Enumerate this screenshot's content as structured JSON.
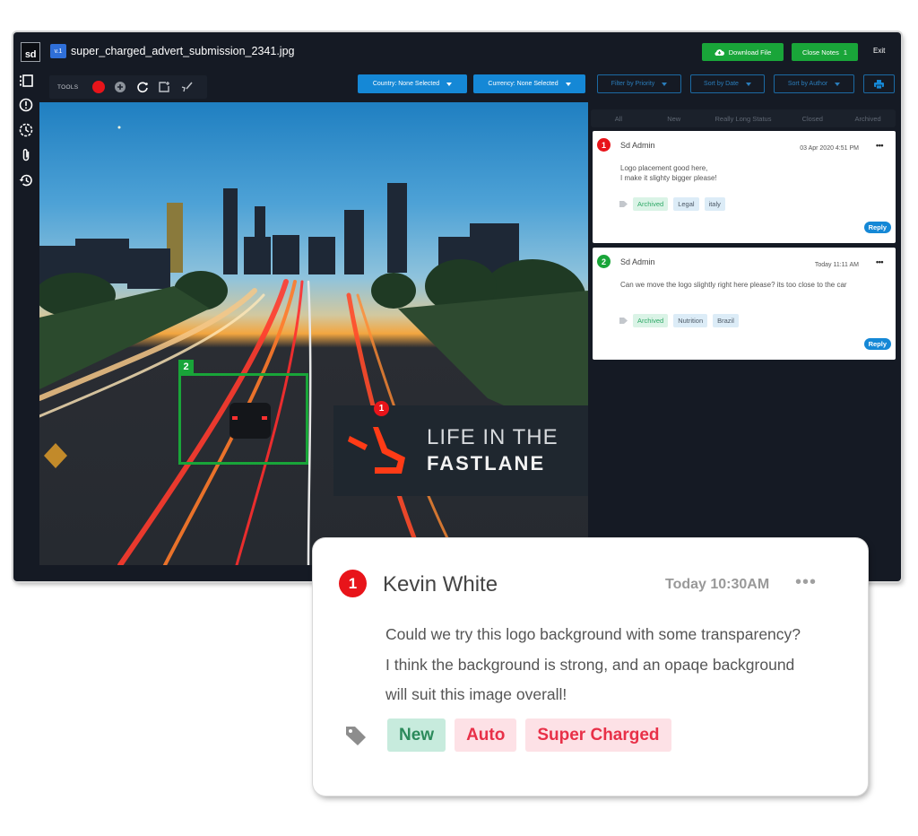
{
  "header": {
    "logo_text": "sd",
    "version_badge": "v.1",
    "file_name": "super_charged_advert_submission_2341.jpg",
    "download_label": "Download File",
    "close_notes_label": "Close Notes",
    "close_notes_count": "1",
    "exit_label": "Exit"
  },
  "rail": {
    "icons": [
      "list-view-icon",
      "alert-circle-icon",
      "clock-dashed-icon",
      "paperclip-icon",
      "history-icon"
    ]
  },
  "toolbar": {
    "label": "TOOLS",
    "tools": [
      "record-dot",
      "add-circle",
      "refresh",
      "add-frame",
      "brush"
    ],
    "active_color": "#e8141a"
  },
  "filters": {
    "country": "Country: None Selected",
    "currency": "Currency: None Selected",
    "priority": "Filter by Priority",
    "date": "Sort by Date",
    "author": "Sort by Author"
  },
  "canvas": {
    "brand_line1": "LIFE IN THE",
    "brand_line2": "FASTLANE",
    "pin_1": "1",
    "pin_2": "2"
  },
  "status_tabs": [
    "All",
    "New",
    "Really Long Status",
    "Closed",
    "Archived"
  ],
  "comments": [
    {
      "number": "1",
      "author": "Sd Admin",
      "time": "03 Apr 2020 4:51 PM",
      "text_lines": [
        "Logo placement good here,",
        "I make it slighty bigger please!"
      ],
      "tags": [
        "Archived",
        "Legal",
        "italy"
      ],
      "reply_label": "Reply",
      "more": "•••"
    },
    {
      "number": "2",
      "author": "Sd Admin",
      "time": "Today 11:11 AM",
      "text_lines": [
        "Can we move the logo slightly right here please? its too close to the car"
      ],
      "tags": [
        "Archived",
        "Nutrition",
        "Brazil"
      ],
      "reply_label": "Reply",
      "more": "•••"
    }
  ],
  "popup": {
    "number": "1",
    "author": "Kevin White",
    "time": "Today 10:30AM",
    "more": "•••",
    "text_lines": [
      "Could we try this logo background with some transparency?",
      "I think the background is strong, and an opaqe background",
      "will suit this image overall!"
    ],
    "tags": [
      "New",
      "Auto",
      "Super Charged"
    ]
  },
  "colors": {
    "frame_bg": "#151a24",
    "accent_blue": "#1588d6",
    "accent_green": "#19a539",
    "pin_red": "#e8141a"
  }
}
